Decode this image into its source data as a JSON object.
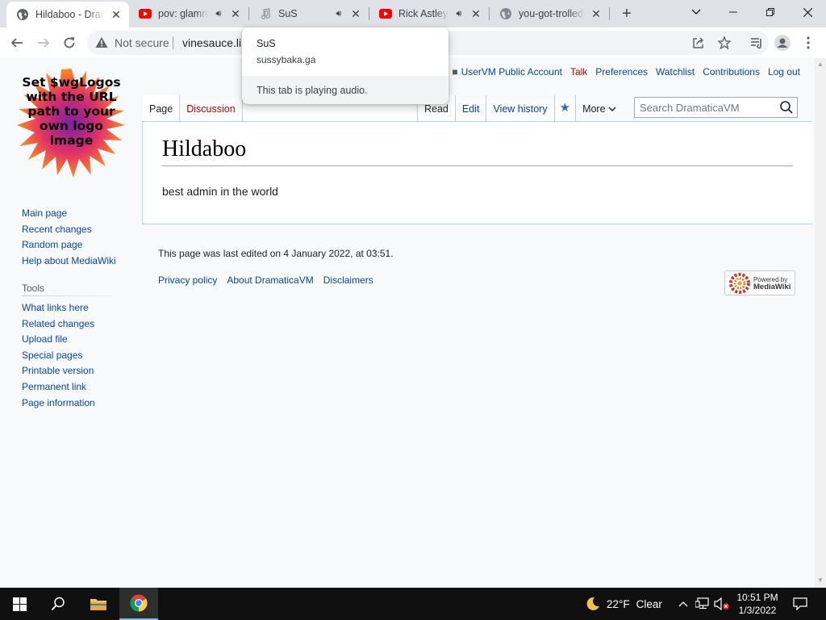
{
  "browser": {
    "tabs": [
      {
        "title": "Hildaboo - DramaticaVM",
        "favicon": "globe-icon",
        "active": true,
        "audio": false
      },
      {
        "title": "pov: glamrock",
        "favicon": "youtube-icon",
        "active": false,
        "audio": true
      },
      {
        "title": "SuS",
        "favicon": "music-note-icon",
        "active": false,
        "audio": true
      },
      {
        "title": "Rick Astley",
        "favicon": "youtube-icon",
        "active": false,
        "audio": true
      },
      {
        "title": "you-got-trolled",
        "favicon": "globe-icon",
        "active": false,
        "audio": false
      }
    ],
    "omnibox": {
      "security_label": "Not secure",
      "url": "vinesauce.li"
    },
    "hovercard": {
      "title": "SuS",
      "domain": "sussybaka.ga",
      "footer": "This tab is playing audio."
    }
  },
  "wiki": {
    "logo_text": "Set $wgLogos with the URL path to your own logo image",
    "personal": {
      "user": "UserVM Public Account",
      "talk": "Talk",
      "preferences": "Preferences",
      "watchlist": "Watchlist",
      "contributions": "Contributions",
      "logout": "Log out"
    },
    "namespaces": {
      "page": "Page",
      "discussion": "Discussion"
    },
    "views": {
      "read": "Read",
      "edit": "Edit",
      "history": "View history",
      "more": "More"
    },
    "search": {
      "placeholder": "Search DramaticaVM"
    },
    "page_title": "Hildaboo",
    "body_text": "best admin in the world",
    "navigation": [
      "Main page",
      "Recent changes",
      "Random page",
      "Help about MediaWiki"
    ],
    "tools_heading": "Tools",
    "tools": [
      "What links here",
      "Related changes",
      "Upload file",
      "Special pages",
      "Printable version",
      "Permanent link",
      "Page information"
    ],
    "footer": {
      "last_edited": "This page was last edited on 4 January 2022, at 03:51.",
      "privacy": "Privacy policy",
      "about": "About DramaticaVM",
      "disclaimers": "Disclaimers",
      "powered_small": "Powered by",
      "powered_big": "MediaWiki"
    }
  },
  "taskbar": {
    "weather": {
      "temp": "22°F",
      "condition": "Clear"
    },
    "clock": {
      "time": "10:51 PM",
      "date": "1/3/2022"
    }
  },
  "colors": {
    "link": "#0645ad",
    "new_link": "#ba0000",
    "taskbar": "#101010",
    "tabstrip": "#dee1e6"
  }
}
